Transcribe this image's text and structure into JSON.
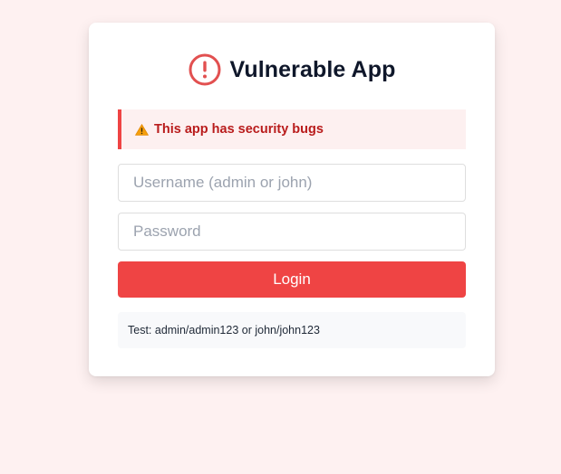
{
  "app": {
    "title": "Vulnerable App",
    "title_icon": "exclamation-circle-icon"
  },
  "warning": {
    "icon": "warning-triangle-icon",
    "text": "This app has security bugs"
  },
  "form": {
    "username_placeholder": "Username (admin or john)",
    "username_value": "",
    "password_placeholder": "Password",
    "password_value": "",
    "login_label": "Login"
  },
  "hint": {
    "text": "Test: admin/admin123 or john/john123"
  },
  "colors": {
    "page_background": "#fef1f1",
    "accent": "#ef4444",
    "warning_text": "#b91c1c",
    "warning_background": "#fdf0f0",
    "hint_background": "#f8f9fb"
  }
}
